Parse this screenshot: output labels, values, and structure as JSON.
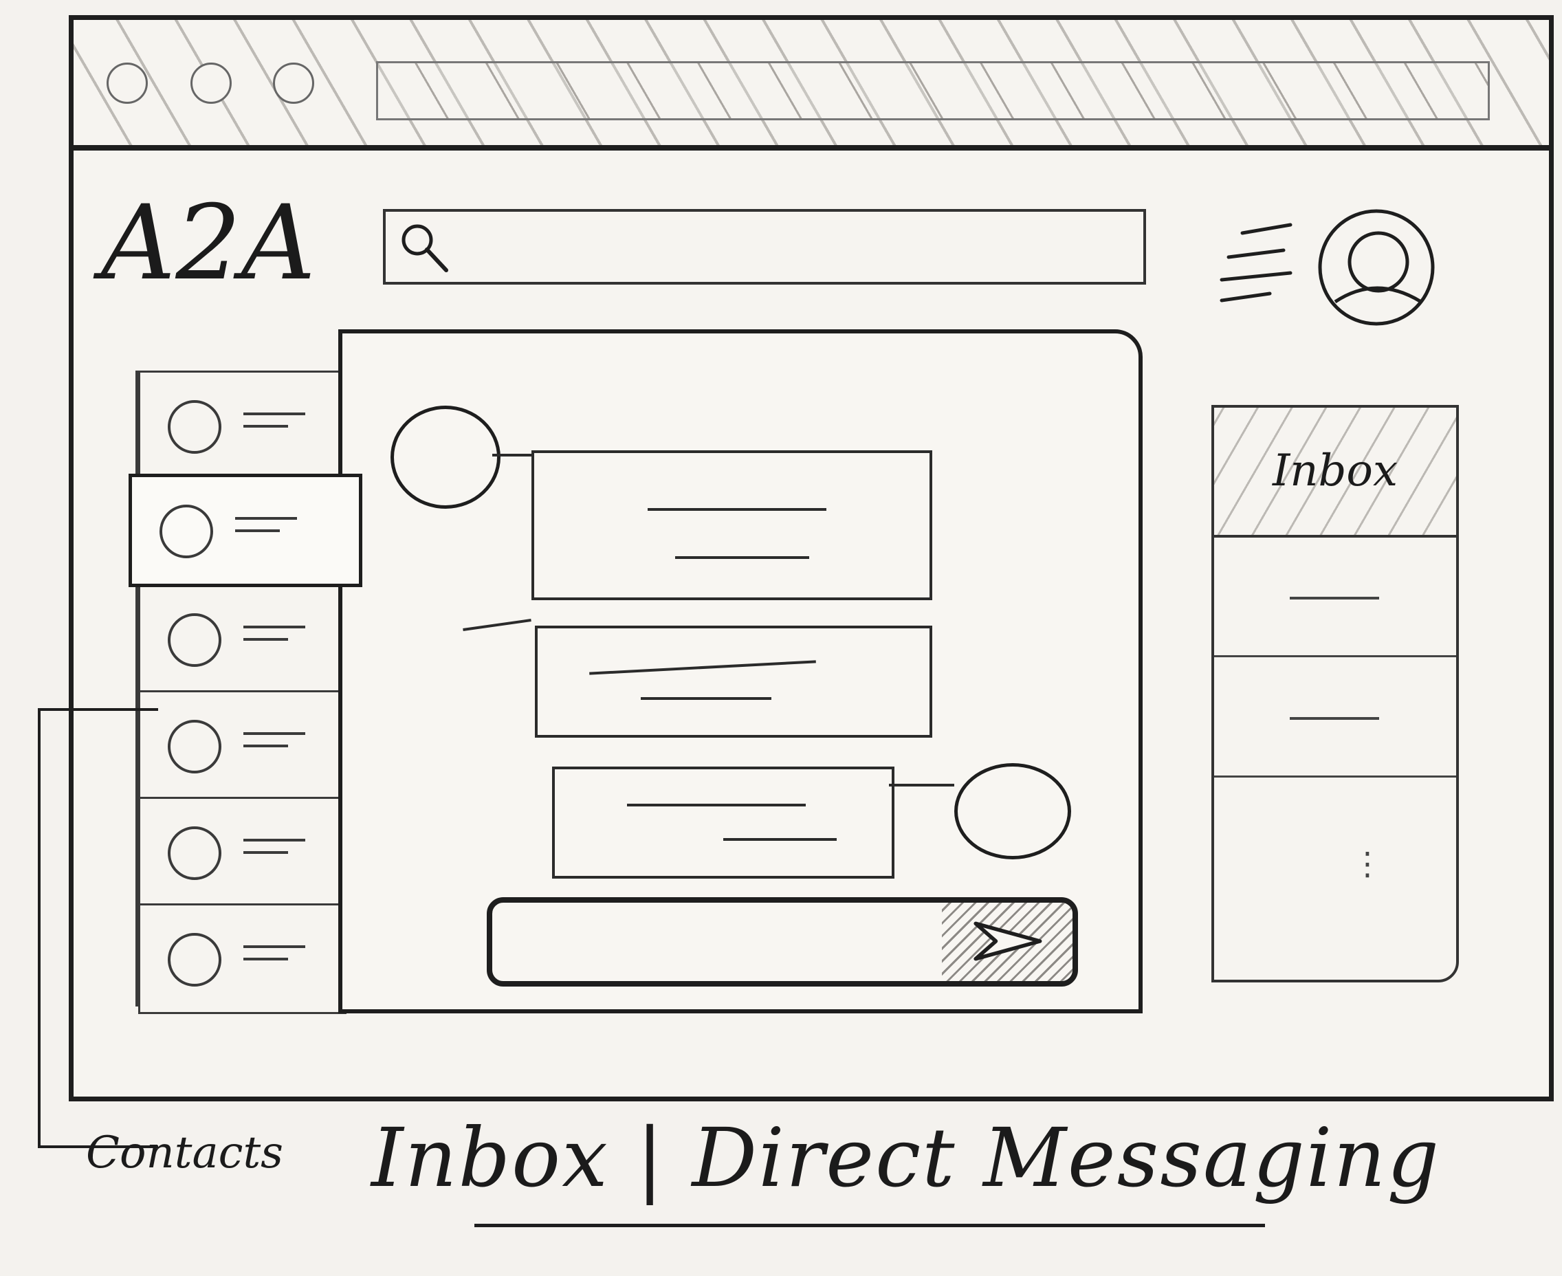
{
  "header": {
    "logo": "A2A",
    "search_placeholder": ""
  },
  "icons": {
    "search": "search-icon",
    "menu": "menu-icon",
    "profile": "user-avatar-icon",
    "send": "send-icon"
  },
  "contacts": {
    "count": 6,
    "active_index": 1
  },
  "chat": {
    "input_placeholder": "",
    "input_text": ""
  },
  "inbox": {
    "title": "Inbox",
    "more": "⋮"
  },
  "annotations": {
    "contacts_label": "Contacts",
    "page_caption": "Inbox | Direct Messaging"
  }
}
